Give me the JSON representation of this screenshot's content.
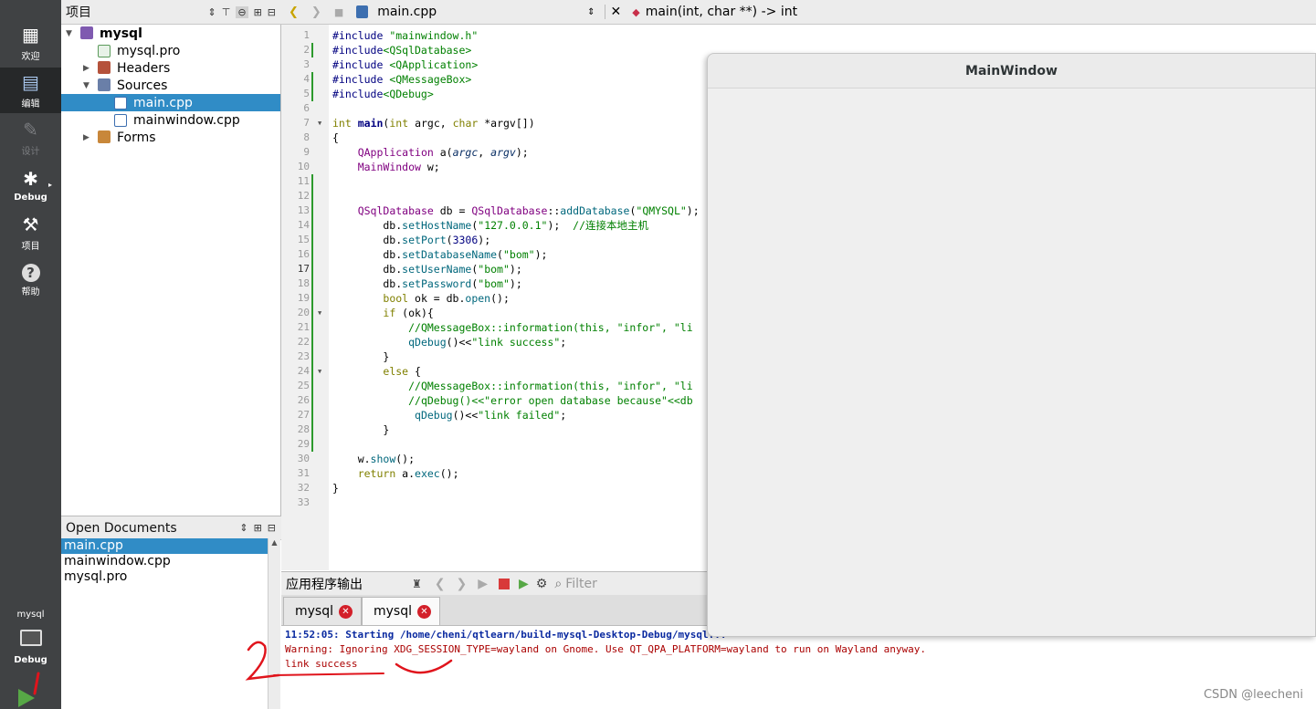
{
  "modes": [
    {
      "label": "欢迎",
      "icon": "▦"
    },
    {
      "label": "编辑",
      "icon": "▤"
    },
    {
      "label": "设计",
      "icon": "✎"
    },
    {
      "label": "Debug",
      "icon": "✱"
    },
    {
      "label": "项目",
      "icon": "🔧"
    },
    {
      "label": "帮助",
      "icon": "?"
    }
  ],
  "kit": {
    "project": "mysql",
    "label": "Debug"
  },
  "project_header": {
    "title": "项目"
  },
  "tree": [
    {
      "label": "mysql",
      "level": 0
    },
    {
      "label": "mysql.pro",
      "level": 1
    },
    {
      "label": "Headers",
      "level": 1
    },
    {
      "label": "Sources",
      "level": 1
    },
    {
      "label": "main.cpp",
      "level": 2
    },
    {
      "label": "mainwindow.cpp",
      "level": 2
    },
    {
      "label": "Forms",
      "level": 1
    }
  ],
  "open_docs": {
    "title": "Open Documents",
    "items": [
      "main.cpp",
      "mainwindow.cpp",
      "mysql.pro"
    ]
  },
  "editor": {
    "file": "main.cpp",
    "symbol": "main(int, char **) -> int"
  },
  "code_lines": [
    "#include \"mainwindow.h\"",
    "#include<QSqlDatabase>",
    "#include <QApplication>",
    "#include <QMessageBox>",
    "#include<QDebug>",
    "",
    "int main(int argc, char *argv[])",
    "{",
    "    QApplication a(argc, argv);",
    "    MainWindow w;",
    "",
    "",
    "    QSqlDatabase db = QSqlDatabase::addDatabase(\"QMYSQL\");",
    "        db.setHostName(\"127.0.0.1\");  //连接本地主机",
    "        db.setPort(3306);",
    "        db.setDatabaseName(\"bom\");",
    "        db.setUserName(\"bom\");",
    "        db.setPassword(\"bom\");",
    "        bool ok = db.open();",
    "        if (ok){",
    "            //QMessageBox::information(this, \"infor\", \"li",
    "            qDebug()<<\"link success\";",
    "        }",
    "        else {",
    "            //QMessageBox::information(this, \"infor\", \"li",
    "            //qDebug()<<\"error open database because\"<<db",
    "             qDebug()<<\"link failed\";",
    "        }",
    "",
    "    w.show();",
    "    return a.exec();",
    "}",
    ""
  ],
  "output": {
    "title": "应用程序输出",
    "filter_placeholder": "Filter",
    "tabs": [
      "mysql",
      "mysql"
    ],
    "lines": [
      "11:52:05: Starting /home/cheni/qtlearn/build-mysql-Desktop-Debug/mysql...",
      "Warning: Ignoring XDG_SESSION_TYPE=wayland on Gnome. Use QT_QPA_PLATFORM=wayland to run on Wayland anyway.",
      "link success"
    ]
  },
  "annotations": {
    "number_1": "1",
    "number_2": "2"
  },
  "main_window": {
    "title": "MainWindow"
  },
  "watermark": "CSDN @leecheni",
  "colors": {
    "selection": "#308cc6",
    "modebar": "#404244",
    "run": "#57a846",
    "error_text": "#aa0000",
    "annotation": "#e0141c"
  }
}
